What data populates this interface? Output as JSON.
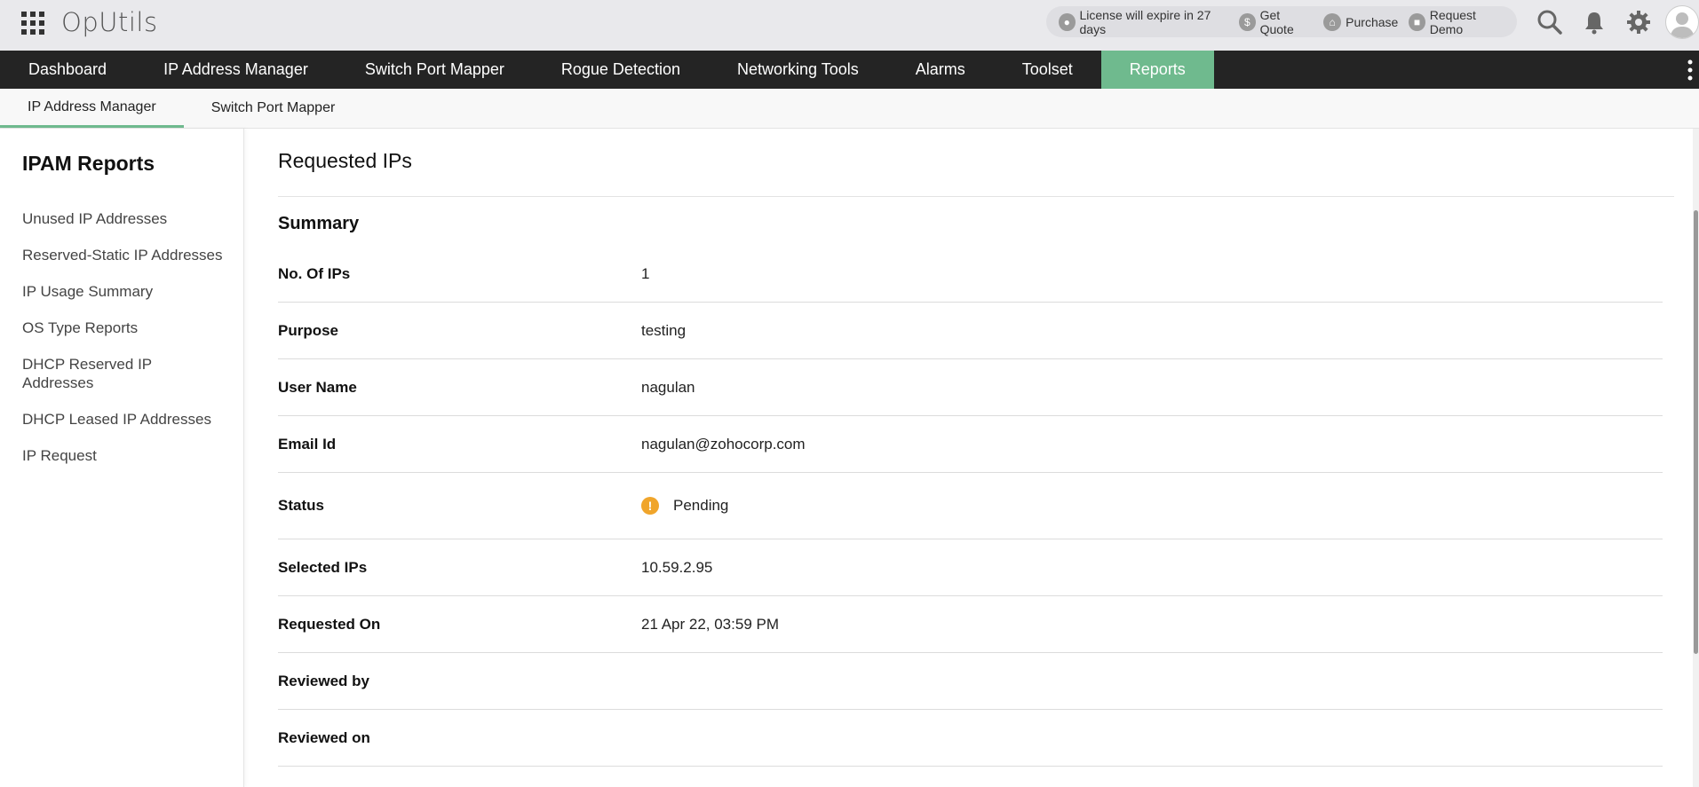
{
  "header": {
    "app_title": "OpUtils",
    "license_text": "License will expire in 27 days",
    "get_quote": "Get Quote",
    "purchase": "Purchase",
    "request_demo": "Request Demo",
    "icons": [
      "apps-grid-icon",
      "search-icon",
      "bell-icon",
      "gear-icon",
      "user-avatar-icon"
    ]
  },
  "main_nav": {
    "items": [
      {
        "label": "Dashboard",
        "active": false
      },
      {
        "label": "IP Address Manager",
        "active": false
      },
      {
        "label": "Switch Port Mapper",
        "active": false
      },
      {
        "label": "Rogue Detection",
        "active": false
      },
      {
        "label": "Networking Tools",
        "active": false
      },
      {
        "label": "Alarms",
        "active": false
      },
      {
        "label": "Toolset",
        "active": false
      },
      {
        "label": "Reports",
        "active": true
      }
    ]
  },
  "sub_nav": {
    "tabs": [
      {
        "label": "IP Address Manager",
        "active": true
      },
      {
        "label": "Switch Port Mapper",
        "active": false
      }
    ]
  },
  "sidebar": {
    "title": "IPAM Reports",
    "items": [
      "Unused IP Addresses",
      "Reserved-Static IP Addresses",
      "IP Usage Summary",
      "OS Type Reports",
      "DHCP Reserved IP Addresses",
      "DHCP Leased IP Addresses",
      "IP Request"
    ]
  },
  "main": {
    "page_title": "Requested IPs",
    "section_title": "Summary",
    "rows": [
      {
        "label": "No. Of IPs",
        "value": "1"
      },
      {
        "label": "Purpose",
        "value": "testing"
      },
      {
        "label": "User Name",
        "value": "nagulan"
      },
      {
        "label": "Email Id",
        "value": "nagulan@zohocorp.com"
      },
      {
        "label": "Status",
        "value": "Pending"
      },
      {
        "label": "Selected IPs",
        "value": "10.59.2.95"
      },
      {
        "label": "Requested On",
        "value": "21 Apr 22, 03:59 PM"
      },
      {
        "label": "Reviewed by",
        "value": ""
      },
      {
        "label": "Reviewed on",
        "value": ""
      }
    ],
    "status_icon": "!"
  },
  "colors": {
    "nav_bg": "#242424",
    "accent_green": "#6fba8e",
    "status_pending": "#f0a52b",
    "header_bg": "#e9e9ec"
  }
}
